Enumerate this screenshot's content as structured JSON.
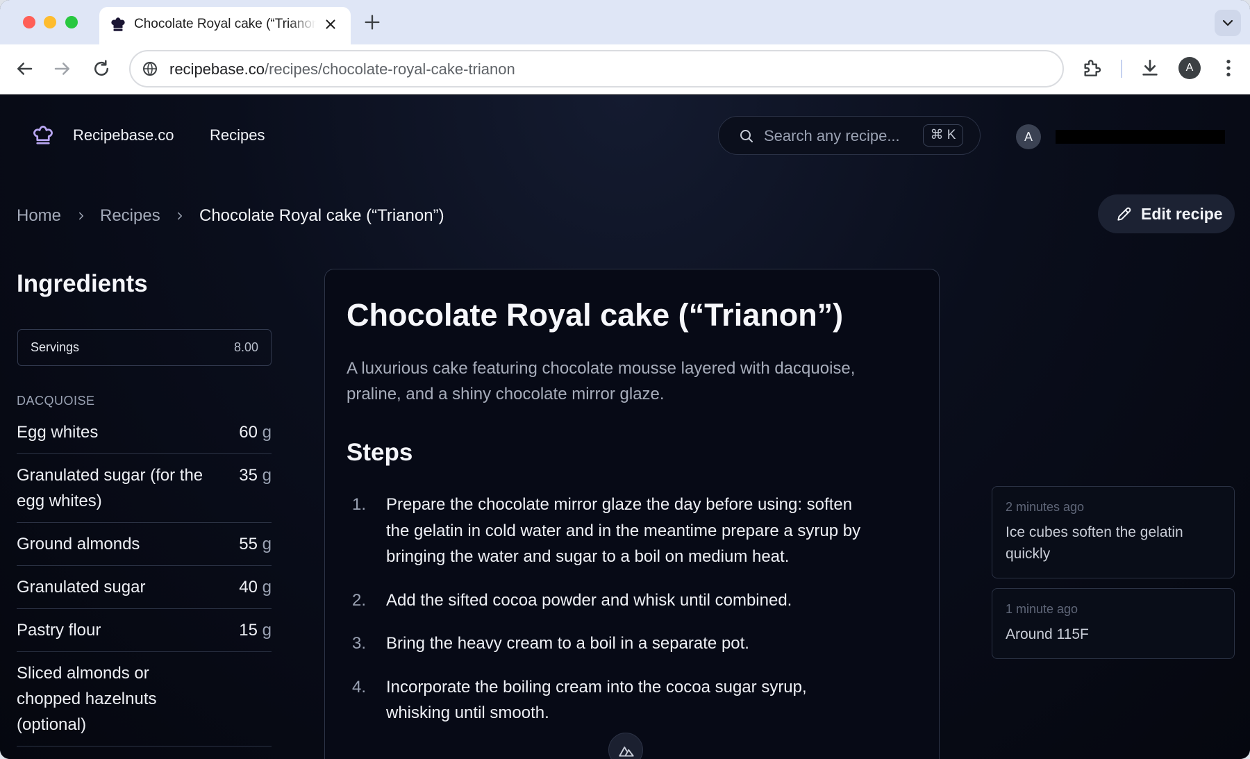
{
  "browser": {
    "tab_title": "Chocolate Royal cake (“Trianon”)",
    "url_host": "recipebase.co",
    "url_path": "/recipes/chocolate-royal-cake-trianon",
    "profile_initial": "A"
  },
  "header": {
    "brand": "Recipebase.co",
    "nav_recipes": "Recipes",
    "search_placeholder": "Search any recipe...",
    "search_shortcut": "⌘ K",
    "user_initial": "A"
  },
  "breadcrumb": {
    "home": "Home",
    "recipes": "Recipes",
    "current": "Chocolate Royal cake (“Trianon”)"
  },
  "edit_button": "Edit recipe",
  "ingredients": {
    "title": "Ingredients",
    "servings_label": "Servings",
    "servings_value": "8.00",
    "section": "DACQUOISE",
    "items": [
      {
        "name": "Egg whites",
        "qty": "60",
        "unit": "g"
      },
      {
        "name": "Granulated sugar (for the egg whites)",
        "qty": "35",
        "unit": "g"
      },
      {
        "name": "Ground almonds",
        "qty": "55",
        "unit": "g"
      },
      {
        "name": "Granulated sugar",
        "qty": "40",
        "unit": "g"
      },
      {
        "name": "Pastry flour",
        "qty": "15",
        "unit": "g"
      },
      {
        "name": "Sliced almonds or chopped hazelnuts (optional)",
        "qty": "",
        "unit": ""
      }
    ]
  },
  "recipe": {
    "title": "Chocolate Royal cake (“Trianon”)",
    "description": "A luxurious cake featuring chocolate mousse layered with dacquoise, praline, and a shiny chocolate mirror glaze.",
    "steps_title": "Steps",
    "steps": [
      {
        "num": "1.",
        "text": "Prepare the chocolate mirror glaze the day before using: soften the gelatin in cold water and in the meantime prepare a syrup by bringing the water and sugar to a boil on medium heat."
      },
      {
        "num": "2.",
        "text": "Add the sifted cocoa powder and whisk until combined."
      },
      {
        "num": "3.",
        "text": "Bring the heavy cream to a boil in a separate pot."
      },
      {
        "num": "4.",
        "text": "Incorporate the boiling cream into the cocoa sugar syrup, whisking until smooth."
      }
    ]
  },
  "comments": [
    {
      "time": "2 minutes ago",
      "text": "Ice cubes soften the gelatin quickly"
    },
    {
      "time": "1 minute ago",
      "text": "Around 115F"
    }
  ],
  "colors": {
    "page_bg": "#070a14",
    "card_border": "#2d3447",
    "muted_text": "#a3aab9",
    "tabbar_bg": "#dfe6f6"
  },
  "icons": [
    "chef-hat-icon",
    "close-icon",
    "plus-icon",
    "chevron-down-icon",
    "back-arrow-icon",
    "forward-arrow-icon",
    "reload-icon",
    "site-info-icon",
    "extensions-icon",
    "download-icon",
    "kebab-menu-icon",
    "search-icon",
    "chevron-right-icon",
    "pencil-icon",
    "nuxt-devtools-icon"
  ]
}
